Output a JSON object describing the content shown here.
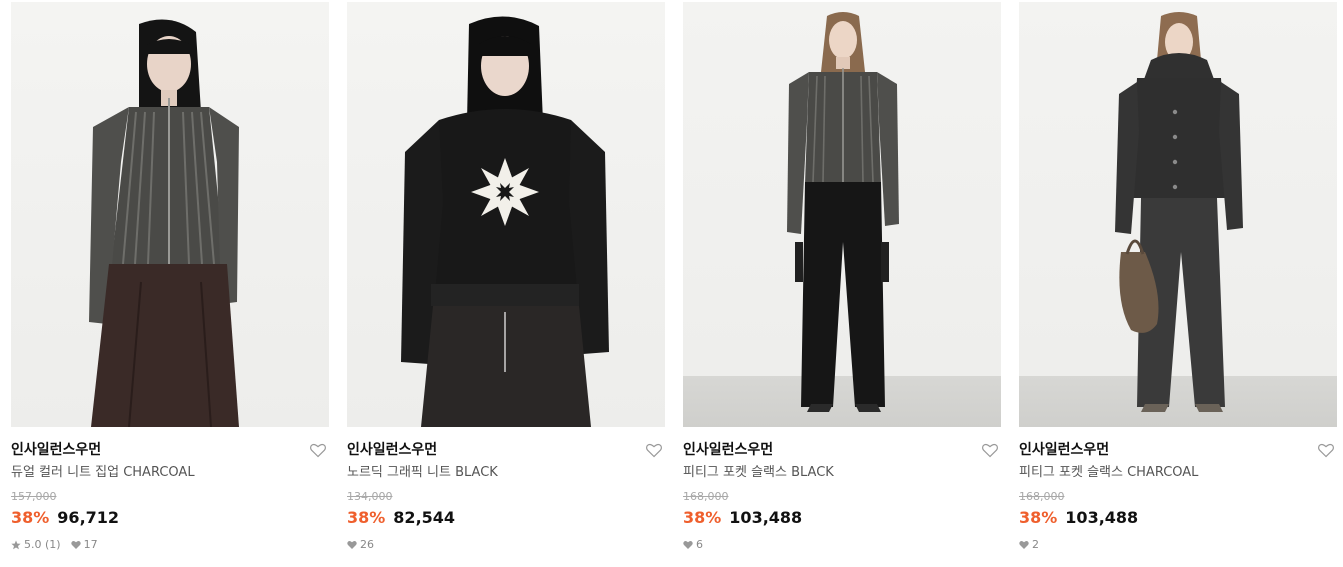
{
  "products": [
    {
      "brand": "인사일런스우먼",
      "name": "듀얼 컬러 니트 집업 CHARCOAL",
      "original_price": "157,000",
      "discount": "38%",
      "price": "96,712",
      "rating": "5.0 (1)",
      "likes": "17"
    },
    {
      "brand": "인사일런스우먼",
      "name": "노르딕 그래픽 니트 BLACK",
      "original_price": "134,000",
      "discount": "38%",
      "price": "82,544",
      "likes": "26"
    },
    {
      "brand": "인사일런스우먼",
      "name": "피티그 포켓 슬랙스 BLACK",
      "original_price": "168,000",
      "discount": "38%",
      "price": "103,488",
      "likes": "6"
    },
    {
      "brand": "인사일런스우먼",
      "name": "피티그 포켓 슬랙스 CHARCOAL",
      "original_price": "168,000",
      "discount": "38%",
      "price": "103,488",
      "likes": "2"
    }
  ],
  "icons": {
    "wishlist": "heart-outline-icon",
    "rating": "star-icon",
    "likes": "heart-icon"
  },
  "colors": {
    "discount": "#ef5f2d",
    "original_price": "#a8a8a8",
    "meta": "#888888"
  }
}
